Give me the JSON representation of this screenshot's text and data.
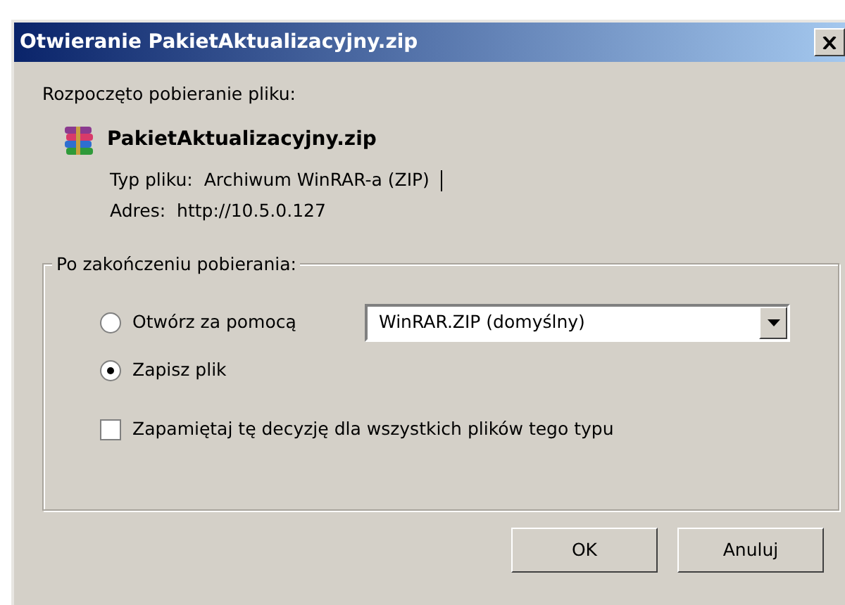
{
  "window": {
    "title": "Otwieranie PakietAktualizacyjny.zip"
  },
  "intro": "Rozpoczęto pobieranie pliku:",
  "file": {
    "name": "PakietAktualizacyjny.zip",
    "type_label": "Typ pliku:",
    "type_value": "Archiwum WinRAR-a (ZIP)",
    "address_label": "Adres:",
    "address_value": "http://10.5.0.127"
  },
  "after_download": {
    "legend": "Po zakończeniu pobierania:",
    "options": [
      {
        "label": "Otwórz za pomocą",
        "selected": false,
        "app": "WinRAR.ZIP (domyślny)"
      },
      {
        "label": "Zapisz plik",
        "selected": true
      }
    ],
    "remember": {
      "label": "Zapamiętaj tę decyzję dla wszystkich plików tego typu",
      "checked": false
    }
  },
  "buttons": [
    "OK",
    "Anuluj"
  ]
}
